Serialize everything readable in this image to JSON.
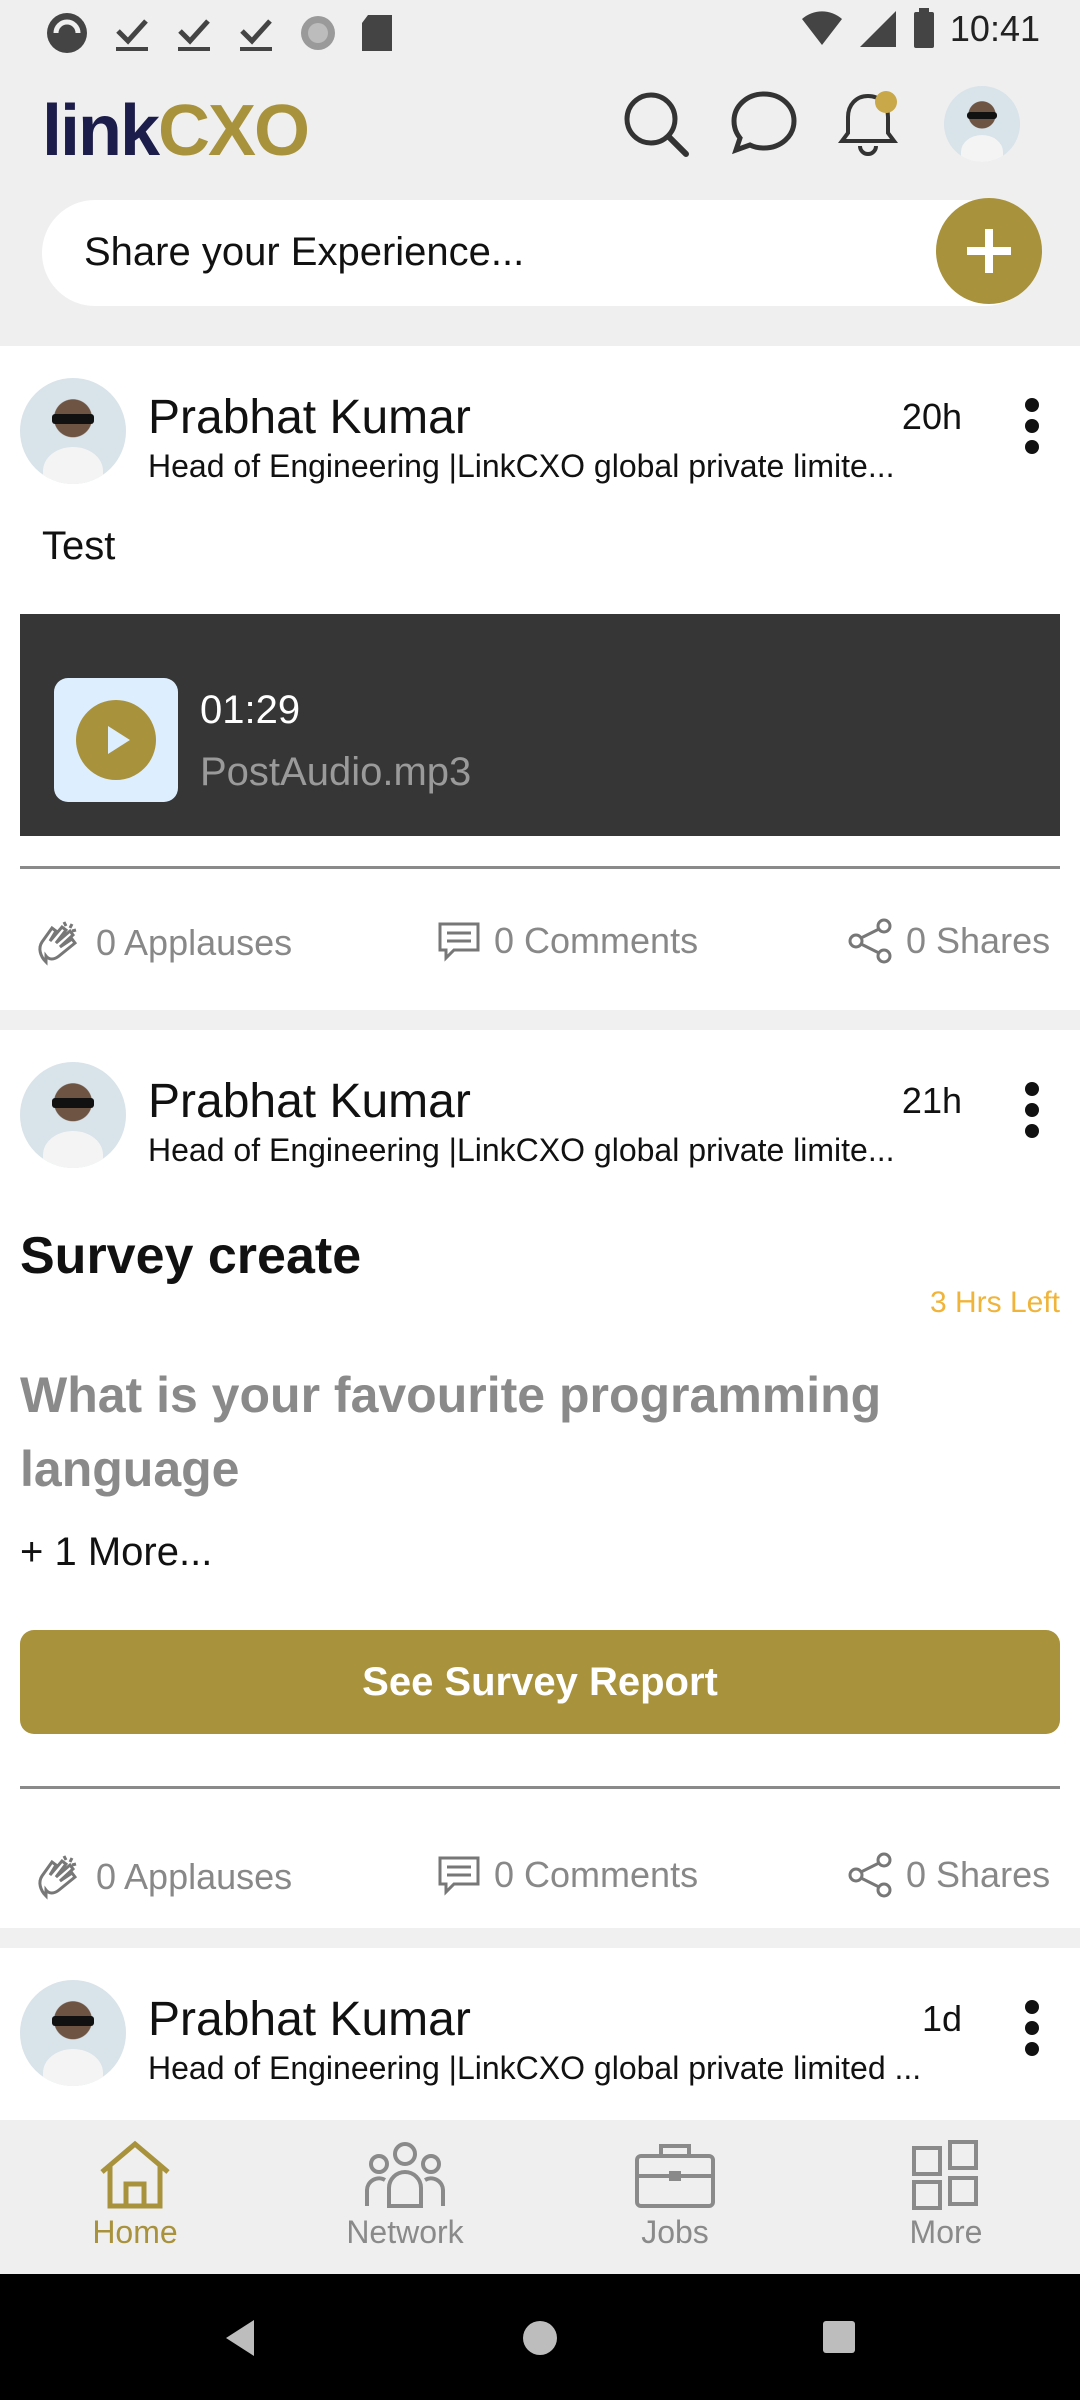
{
  "status_bar": {
    "time": "10:41",
    "left_icons": [
      "app-badge-icon",
      "check-download-icon",
      "check-download-icon",
      "check-download-icon",
      "sync-circle-icon",
      "sd-card-icon"
    ],
    "right_icons": [
      "wifi-icon",
      "signal-icon",
      "battery-icon"
    ]
  },
  "header": {
    "logo_part1": "link",
    "logo_part2": "CXO",
    "share_placeholder": "Share your Experience...",
    "icons": [
      "search-icon",
      "chat-icon",
      "bell-icon",
      "profile-avatar"
    ]
  },
  "posts": [
    {
      "author": "Prabhat Kumar",
      "title": "Head of Engineering |LinkCXO global private limite...",
      "time": "20h",
      "text": "Test",
      "audio": {
        "duration": "01:29",
        "filename": "PostAudio.mp3"
      },
      "applauses": "0 Applauses",
      "comments": "0 Comments",
      "shares": "0 Shares"
    },
    {
      "author": "Prabhat Kumar",
      "title": "Head of Engineering |LinkCXO global private limite...",
      "time": "21h",
      "survey": {
        "title": "Survey create",
        "time_left": "3 Hrs Left",
        "question": "What is your favourite programming language",
        "more": "+ 1 More...",
        "button": "See Survey Report"
      },
      "applauses": "0 Applauses",
      "comments": "0 Comments",
      "shares": "0 Shares"
    },
    {
      "author": "Prabhat Kumar",
      "title": "Head of Engineering |LinkCXO global private limited  ...",
      "time": "1d"
    }
  ],
  "bottom_nav": {
    "items": [
      {
        "label": "Home",
        "icon": "home-icon",
        "active": true
      },
      {
        "label": "Network",
        "icon": "network-icon",
        "active": false
      },
      {
        "label": "Jobs",
        "icon": "briefcase-icon",
        "active": false
      },
      {
        "label": "More",
        "icon": "grid-icon",
        "active": false
      }
    ]
  },
  "colors": {
    "accent": "#a8923c",
    "brand_dark": "#1c1d4a",
    "warning": "#f0b43a"
  }
}
